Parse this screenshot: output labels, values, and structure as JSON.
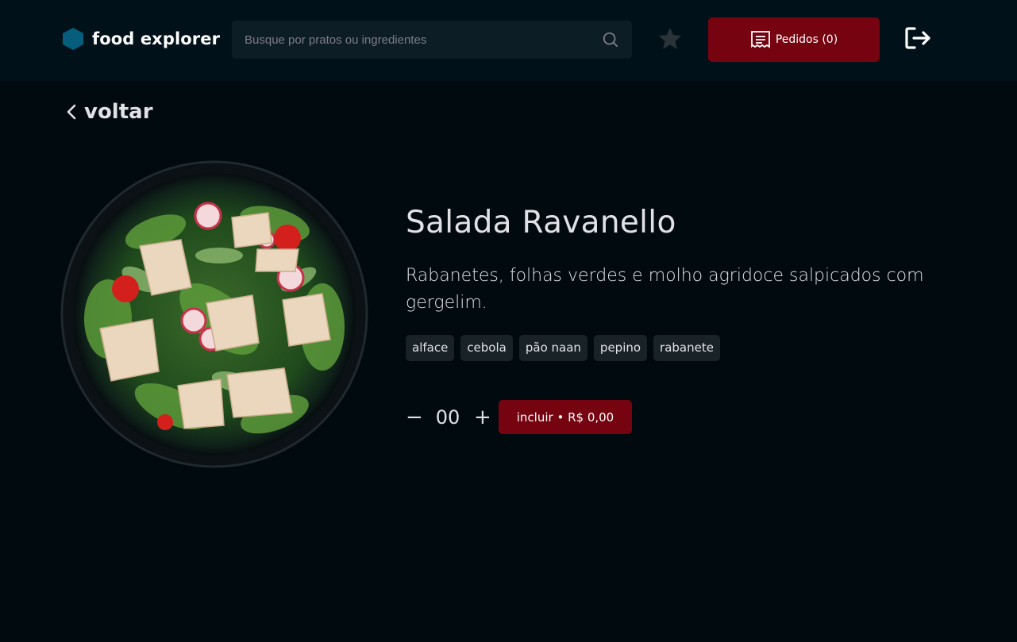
{
  "header": {
    "brand": "food explorer",
    "search_placeholder": "Busque por pratos ou ingredientes",
    "orders_label": "Pedidos (0)"
  },
  "nav": {
    "back_label": "voltar"
  },
  "dish": {
    "name": "Salada Ravanello",
    "description": "Rabanetes, folhas verdes e molho agridoce salpicados com gergelim.",
    "ingredients": [
      "alface",
      "cebola",
      "pão naan",
      "pepino",
      "rabanete"
    ],
    "quantity": "00",
    "minus": "−",
    "plus": "+",
    "add_label": "incluir • R$ 0,00"
  },
  "icons": [
    "hexagon-logo-icon",
    "search-icon",
    "star-icon",
    "receipt-icon",
    "logout-icon",
    "chevron-left-icon"
  ],
  "colors": {
    "accent": "#750310",
    "logo": "#065e7c",
    "header_bg": "#001119",
    "page_bg": "#000a0f"
  }
}
